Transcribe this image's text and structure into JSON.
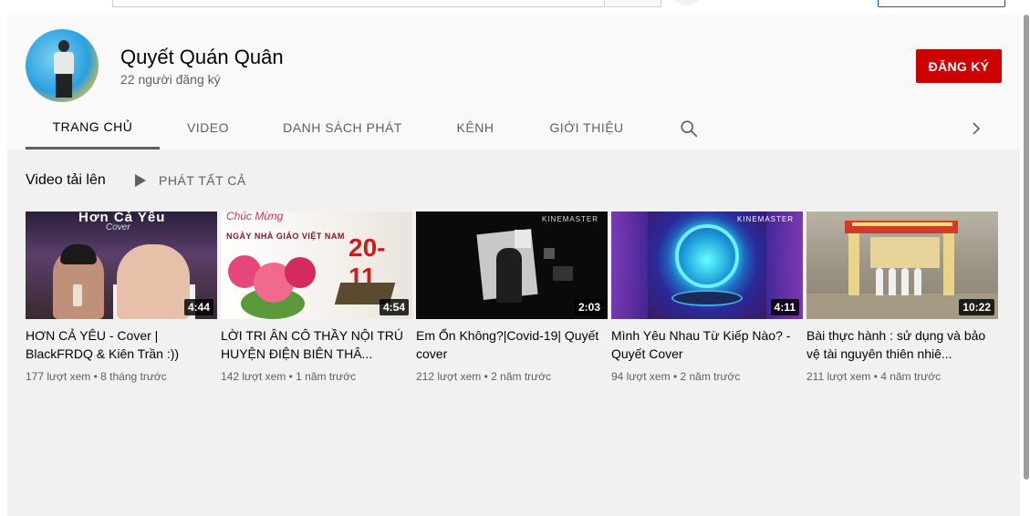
{
  "channel": {
    "name": "Quyết Quán Quân",
    "subscribers": "22 người đăng ký",
    "subscribe_label": "ĐĂNG KÝ"
  },
  "tabs": [
    {
      "label": "TRANG CHỦ",
      "active": true
    },
    {
      "label": "VIDEO",
      "active": false
    },
    {
      "label": "DANH SÁCH PHÁT",
      "active": false
    },
    {
      "label": "KÊNH",
      "active": false
    },
    {
      "label": "GIỚI THIỆU",
      "active": false
    }
  ],
  "shelf": {
    "title": "Video tải lên",
    "play_all_label": "PHÁT TẤT CẢ"
  },
  "thumb_text": {
    "v1_title_overlay": "Hơn Cả Yêu",
    "v1_subtitle_overlay": "Cover",
    "v2_script": "Chúc Mừng",
    "v2_line": "NGÀY NHÀ GIÁO VIỆT NAM",
    "v2_date": "20-11",
    "watermark": "KINEMASTER"
  },
  "videos": [
    {
      "title": "HƠN CẢ YÊU - Cover | BlackFRDQ & Kiên Trần :))",
      "duration": "4:44",
      "views": "177 lượt xem",
      "age": "8 tháng trước"
    },
    {
      "title": "LỜI TRI ÂN CÔ THẦY NỘI TRÚ HUYỆN ĐIỆN BIÊN THÂ...",
      "duration": "4:54",
      "views": "142 lượt xem",
      "age": "1 năm trước"
    },
    {
      "title": "Em Ổn Không?|Covid-19| Quyết cover",
      "duration": "2:03",
      "views": "212 lượt xem",
      "age": "2 năm trước"
    },
    {
      "title": "Mình Yêu Nhau Từ Kiếp Nào? - Quyết Cover",
      "duration": "4:11",
      "views": "94 lượt xem",
      "age": "2 năm trước"
    },
    {
      "title": "Bài thực hành : sử dụng và bảo vệ tài nguyên thiên nhiê...",
      "duration": "10:22",
      "views": "211 lượt xem",
      "age": "4 năm trước"
    }
  ],
  "meta_separator": "•",
  "colors": {
    "subscribe_red": "#cc0000",
    "text_primary": "#030303",
    "text_secondary": "#606060",
    "header_bg": "#f9f9f9",
    "content_bg": "#f1f1f1"
  },
  "icons": {
    "search": "search-icon",
    "next": "chevron-right-icon",
    "play_all": "play-icon"
  }
}
